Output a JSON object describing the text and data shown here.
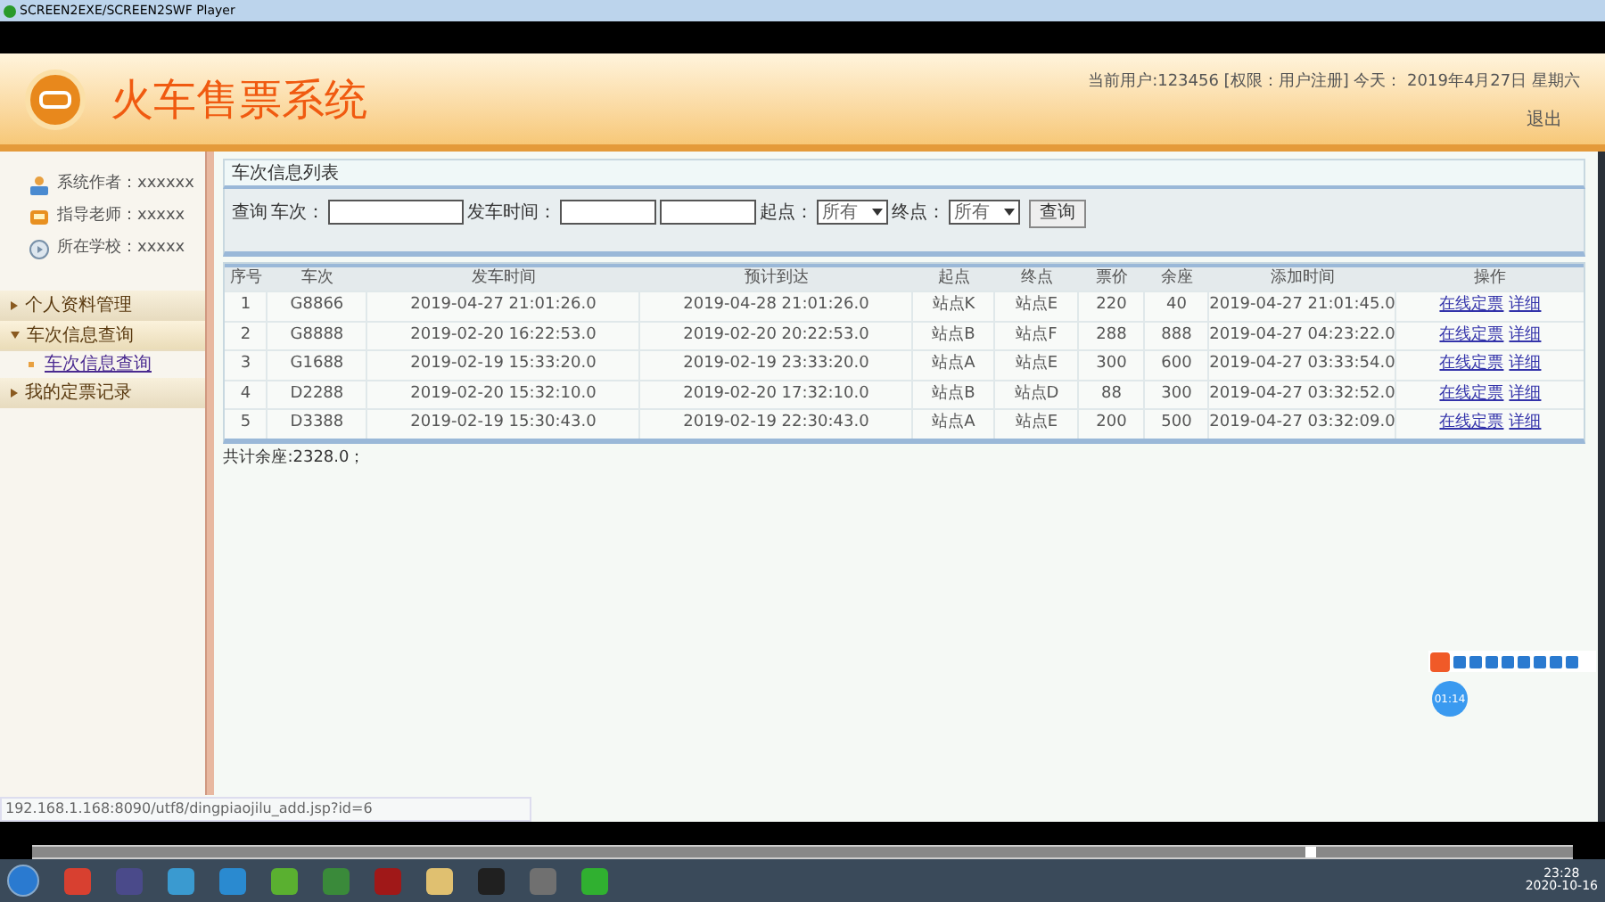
{
  "player": {
    "title": "SCREEN2EXE/SCREEN2SWF Player"
  },
  "header": {
    "title": "火车售票系统",
    "user_info": "当前用户:123456 [权限：用户注册] 今天： 2019年4月27日 星期六",
    "logout": "退出"
  },
  "sidebar": {
    "info": [
      {
        "kind": "author",
        "text": "系统作者：xxxxxx"
      },
      {
        "kind": "teacher",
        "text": "指导老师：xxxxx"
      },
      {
        "kind": "school",
        "text": "所在学校：xxxxx"
      }
    ],
    "menu": [
      {
        "label": "个人资料管理",
        "expanded": false
      },
      {
        "label": "车次信息查询",
        "expanded": true,
        "children": [
          {
            "label": "车次信息查询"
          }
        ]
      },
      {
        "label": "我的定票记录",
        "expanded": false
      }
    ]
  },
  "panel": {
    "title": "车次信息列表",
    "query": {
      "label": "查询",
      "train_label": "车次：",
      "time_label": "发车时间：",
      "from_label": "起点：",
      "from_value": "所有",
      "to_label": "终点：",
      "to_value": "所有",
      "button": "查询"
    },
    "table": {
      "columns": [
        "序号",
        "车次",
        "发车时间",
        "预计到达",
        "起点",
        "终点",
        "票价",
        "余座",
        "添加时间",
        "操作"
      ],
      "rows": [
        {
          "cells": [
            "1",
            "G8866",
            "2019-04-27 21:01:26.0",
            "2019-04-28 21:01:26.0",
            "站点K",
            "站点E",
            "220",
            "40",
            "2019-04-27 21:01:45.0"
          ],
          "actions": [
            "在线定票",
            "详细"
          ]
        },
        {
          "cells": [
            "2",
            "G8888",
            "2019-02-20 16:22:53.0",
            "2019-02-20 20:22:53.0",
            "站点B",
            "站点F",
            "288",
            "888",
            "2019-04-27 04:23:22.0"
          ],
          "actions": [
            "在线定票",
            "详细"
          ]
        },
        {
          "cells": [
            "3",
            "G1688",
            "2019-02-19 15:33:20.0",
            "2019-02-19 23:33:20.0",
            "站点A",
            "站点E",
            "300",
            "600",
            "2019-04-27 03:33:54.0"
          ],
          "actions": [
            "在线定票",
            "详细"
          ]
        },
        {
          "cells": [
            "4",
            "D2288",
            "2019-02-20 15:32:10.0",
            "2019-02-20 17:32:10.0",
            "站点B",
            "站点D",
            "88",
            "300",
            "2019-04-27 03:32:52.0"
          ],
          "actions": [
            "在线定票",
            "详细"
          ]
        },
        {
          "cells": [
            "5",
            "D3388",
            "2019-02-19 15:30:43.0",
            "2019-02-19 22:30:43.0",
            "站点A",
            "站点E",
            "200",
            "500",
            "2019-04-27 03:32:09.0"
          ],
          "actions": [
            "在线定票",
            "详细"
          ]
        }
      ]
    },
    "total": "共计余座:2328.0；"
  },
  "status_url": "192.168.1.168:8090/utf8/dingpiaojilu_add.jsp?id=6",
  "timer": "01:14",
  "player_progress": {
    "level": 0.83
  },
  "taskbar": {
    "time": "23:28",
    "date": "2020-10-16"
  }
}
